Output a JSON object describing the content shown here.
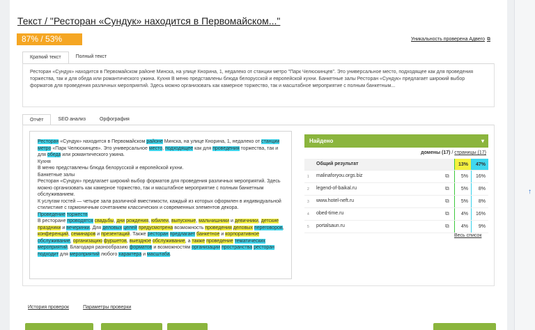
{
  "title": "Текст / \"Ресторан «Сундук» находится в Первомайском...\"",
  "score": "87% / 53%",
  "uniqueness_link": "Уникальность проверена Адвего",
  "tabs_top": [
    "Краткий текст",
    "Полный текст"
  ],
  "summary_text": "Ресторан «Сундук» находится в Первомайском районе Минска, на улице Кнорина, 1, недалеко от станции метро \"Парк Челюскинцев\". Это универсальное место, подходящее как для проведения торжества, так и для обеда или романтического ужина. Кухня В меню представлены блюда белорусской и европейской кухни. Банкетные залы Ресторан «Сундук» предлагает широкий выбор форматов для проведения различных мероприятий. Здесь можно организовать как камерное торжество, так и масштабное мероприятие с полным банкетным...",
  "tabs_report": [
    "Отчёт",
    "SEO анализ",
    "Орфография"
  ],
  "found": {
    "header": "Найдено",
    "domains_label": "домены (17)",
    "pages_label": "страницы (17)",
    "total_label": "Общий результат",
    "total_p1": "13%",
    "total_p2": "47%",
    "rows": [
      {
        "num": "1",
        "name": "malinaforyou.orgs.biz",
        "p1": "5%",
        "p2": "16%"
      },
      {
        "num": "2",
        "name": "legend-of-baikal.ru",
        "p1": "5%",
        "p2": "8%"
      },
      {
        "num": "3",
        "name": "www.hotel-neft.ru",
        "p1": "5%",
        "p2": "8%"
      },
      {
        "num": "4",
        "name": "obed-time.ru",
        "p1": "4%",
        "p2": "16%"
      },
      {
        "num": "5",
        "name": "portalsaun.ru",
        "p1": "4%",
        "p2": "9%"
      }
    ],
    "all_list": "Весь список"
  },
  "bottom_links": [
    "История проверок",
    "Параметры проверки"
  ],
  "colors": {
    "accent_green": "#8bb53d",
    "score_orange": "#f5a623",
    "cyan": "#3fd7ee",
    "yellow": "#f4f13f"
  }
}
